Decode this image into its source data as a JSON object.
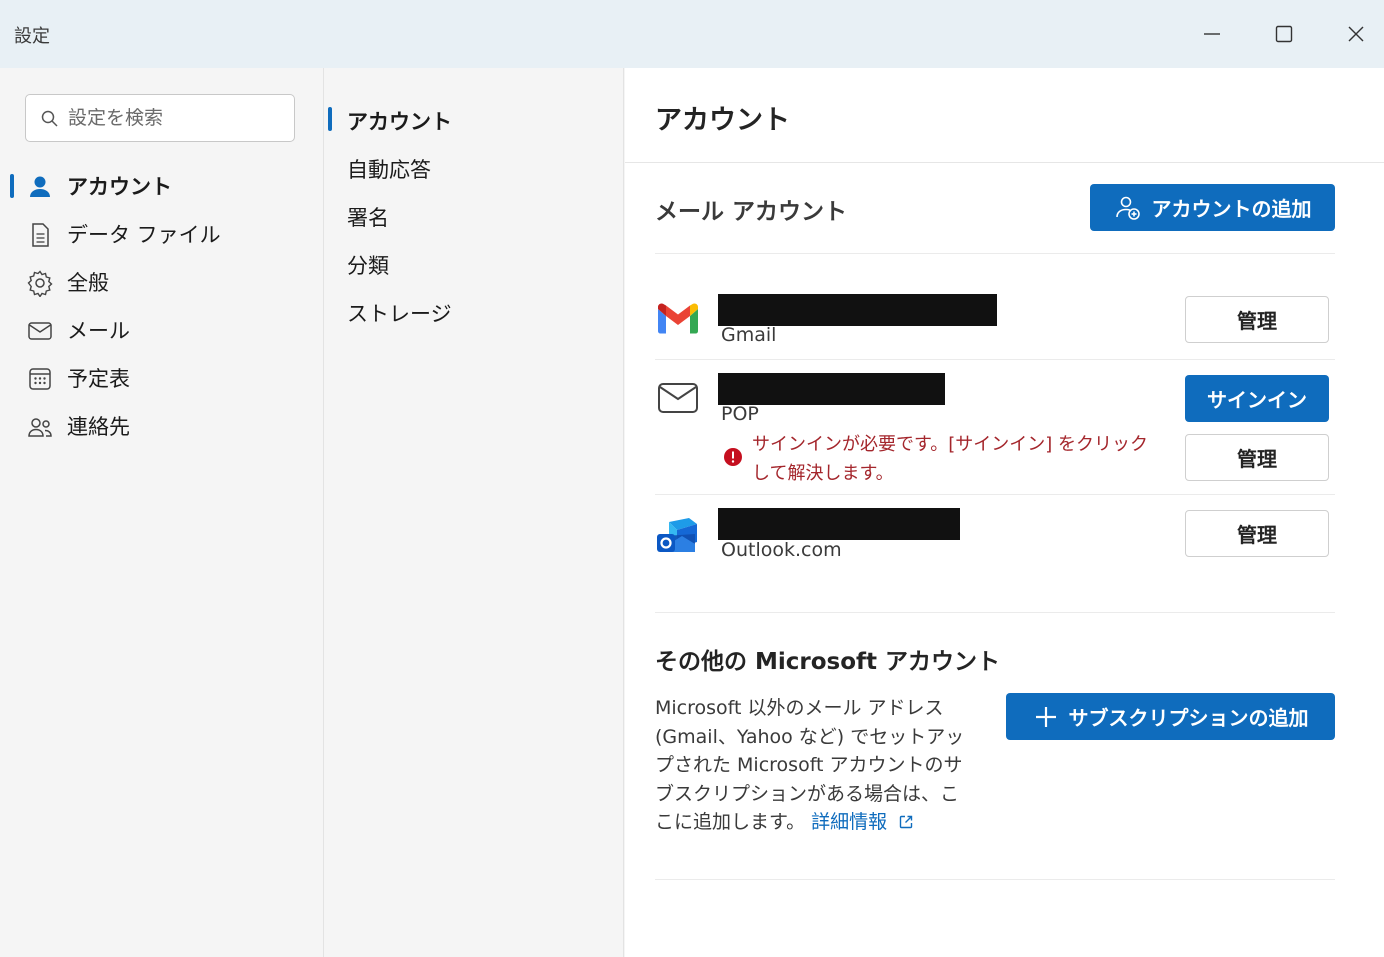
{
  "window": {
    "title": "設定"
  },
  "search": {
    "placeholder": "設定を検索"
  },
  "left_nav": {
    "items": [
      {
        "label": "アカウント",
        "icon": "person-icon",
        "active": true
      },
      {
        "label": "データ ファイル",
        "icon": "document-icon",
        "active": false
      },
      {
        "label": "全般",
        "icon": "gear-icon",
        "active": false
      },
      {
        "label": "メール",
        "icon": "mail-icon",
        "active": false
      },
      {
        "label": "予定表",
        "icon": "calendar-icon",
        "active": false
      },
      {
        "label": "連絡先",
        "icon": "people-icon",
        "active": false
      }
    ]
  },
  "mid_nav": {
    "items": [
      {
        "label": "アカウント",
        "active": true
      },
      {
        "label": "自動応答",
        "active": false
      },
      {
        "label": "署名",
        "active": false
      },
      {
        "label": "分類",
        "active": false
      },
      {
        "label": "ストレージ",
        "active": false
      }
    ]
  },
  "main": {
    "title": "アカウント",
    "mail_accounts": {
      "heading": "メール アカウント",
      "add_button": "アカウントの追加",
      "accounts": [
        {
          "type": "Gmail",
          "icon": "gmail-icon",
          "manage_label": "管理"
        },
        {
          "type": "POP",
          "icon": "mail-icon",
          "signin_label": "サインイン",
          "manage_label": "管理",
          "error": "サインインが必要です。[サインイン] をクリックして解決します。"
        },
        {
          "type": "Outlook.com",
          "icon": "outlook-icon",
          "manage_label": "管理"
        }
      ]
    },
    "other_accounts": {
      "heading": "その他の Microsoft アカウント",
      "description": "Microsoft 以外のメール アドレス (Gmail、Yahoo など) でセットアップされた Microsoft アカウントのサブスクリプションがある場合は、ここに追加します。",
      "link_label": "詳細情報",
      "add_button": "サブスクリプションの追加"
    }
  },
  "colors": {
    "accent": "#0f6cbd",
    "error": "#a4262c",
    "titlebar": "#e8f0f5"
  }
}
